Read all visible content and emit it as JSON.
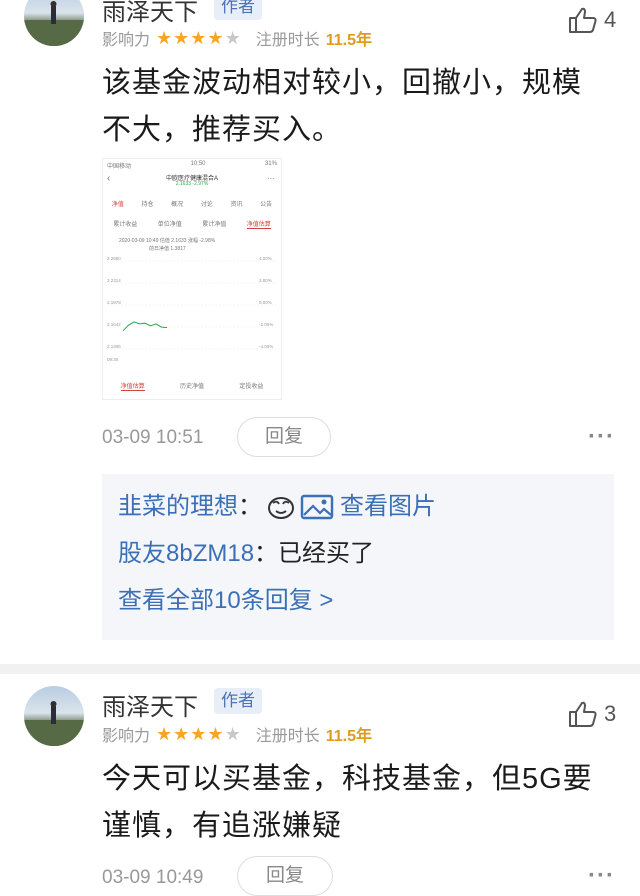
{
  "comments": [
    {
      "author": "雨泽天下",
      "badge": "作者",
      "influence_label": "影响力",
      "stars": 4,
      "stars_total": 5,
      "reg_label": "注册时长",
      "reg_years": "11.5年",
      "likes": "4",
      "content": "该基金波动相对较小，回撤小，规模不大，推荐买入。",
      "time": "03-09 10:51",
      "reply_label": "回复",
      "screenshot": {
        "status_left": "中国移动",
        "status_time": "10:50",
        "status_battery": "31%",
        "fund_name": "中欧医疗健康混合A",
        "fund_sub": "2.1633 -2.97%",
        "tabs": [
          "净值",
          "持仓",
          "概况",
          "讨论",
          "资讯",
          "公告"
        ],
        "subtabs": [
          "累计收益",
          "单位净值",
          "累计净值",
          "净值估算"
        ],
        "est_line": "2020-03-09 10:49  估值 2.1633  涨幅 -2.98%",
        "prev_line": "前日净值 1.3817",
        "y_left": [
          "2.2650",
          "2.2314",
          "2.1978",
          "2.1642",
          "2.1306"
        ],
        "y_right": [
          "4.00%",
          "2.00%",
          "0.00%",
          "-2.00%",
          "-4.00%"
        ],
        "x_start": "09:30",
        "chart_data": {
          "type": "line",
          "x": [
            "09:30",
            "09:40",
            "09:50",
            "10:00",
            "10:10",
            "10:20",
            "10:30",
            "10:40",
            "10:49"
          ],
          "values": [
            2.1585,
            2.167,
            2.172,
            2.169,
            2.17,
            2.166,
            2.169,
            2.164,
            2.1633
          ],
          "ylim": [
            2.1306,
            2.265
          ]
        },
        "bottom_tabs": [
          "净值估算",
          "历史净值",
          "定投收益"
        ]
      }
    },
    {
      "author": "雨泽天下",
      "badge": "作者",
      "influence_label": "影响力",
      "stars": 4,
      "stars_total": 5,
      "reg_label": "注册时长",
      "reg_years": "11.5年",
      "likes": "3",
      "content": "今天可以买基金，科技基金，但5G要谨慎，有追涨嫌疑",
      "time": "03-09 10:49",
      "reply_label": "回复"
    }
  ],
  "replies": [
    {
      "user": "韭菜的理想",
      "sep": "：",
      "view_image_label": "查看图片"
    },
    {
      "user": "股友8bZM18",
      "sep": "：",
      "text": "已经买了"
    }
  ],
  "view_all_label": "查看全部10条回复 >",
  "colors": {
    "accent": "#3b6fb6",
    "star": "#f5a623",
    "years": "#e09a1e"
  }
}
